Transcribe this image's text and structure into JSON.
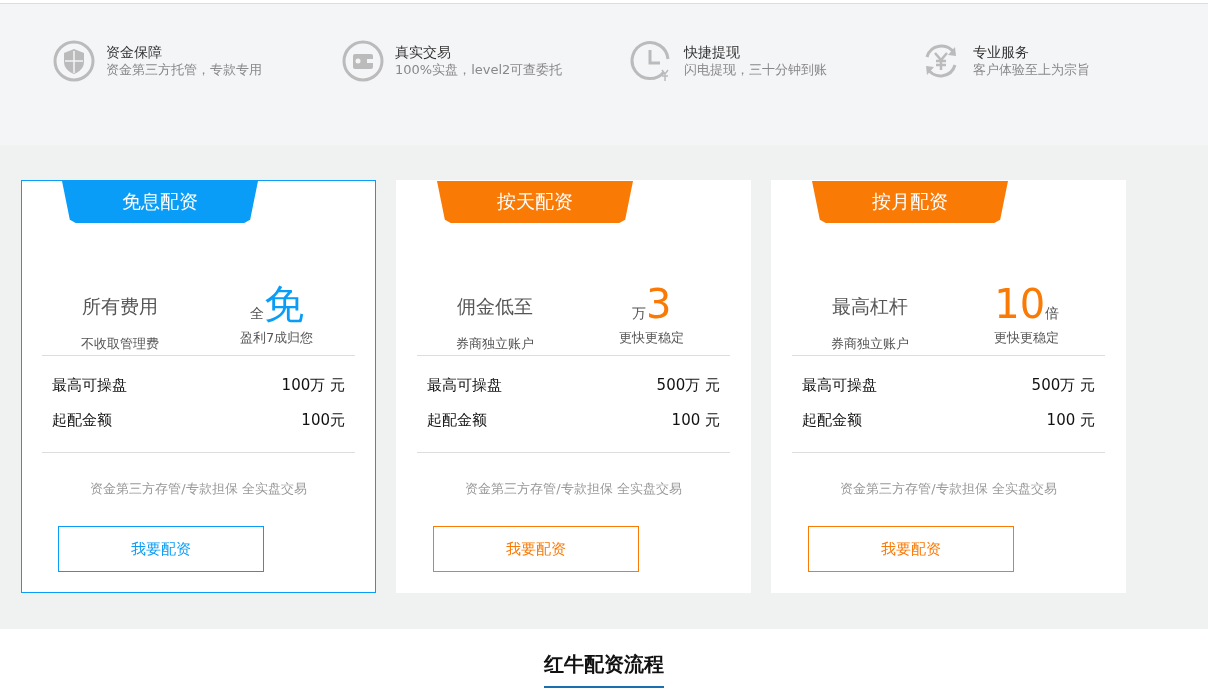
{
  "features": [
    {
      "kind": "shield",
      "title": "资金保障",
      "desc": "资金第三方托管，专款专用"
    },
    {
      "kind": "wallet",
      "title": "真实交易",
      "desc": "100%实盘，level2可查委托"
    },
    {
      "kind": "clock",
      "title": "快捷提现",
      "desc": "闪电提现，三十分钟到账"
    },
    {
      "kind": "exchange",
      "title": "专业服务",
      "desc": "客户体验至上为宗旨"
    }
  ],
  "plans": [
    {
      "selected": true,
      "color": "#0a9df7",
      "tab": "免息配资",
      "left_title": "所有费用",
      "left_sub": "不收取管理费",
      "figure_prefix": "全",
      "figure": "免",
      "right_sub": "盈利7成归您",
      "rows": [
        {
          "label": "最高可操盘",
          "value": "100万 元"
        },
        {
          "label": "起配金额",
          "value": "100元"
        }
      ],
      "note": "资金第三方存管/专款担保 全实盘交易",
      "button": "我要配资"
    },
    {
      "selected": false,
      "color": "#fa7a06",
      "tab": "按天配资",
      "left_title": "佣金低至",
      "left_sub": "券商独立账户",
      "figure_prefix": "万",
      "figure": "3",
      "right_sub": "更快更稳定",
      "rows": [
        {
          "label": "最高可操盘",
          "value": "500万 元"
        },
        {
          "label": "起配金额",
          "value": "100 元"
        }
      ],
      "note": "资金第三方存管/专款担保 全实盘交易",
      "button": "我要配资"
    },
    {
      "selected": false,
      "color": "#fa7a06",
      "tab": "按月配资",
      "left_title": "最高杠杆",
      "left_sub": "券商独立账户",
      "figure": "10",
      "figure_suffix": "倍",
      "right_sub": "更快更稳定",
      "rows": [
        {
          "label": "最高可操盘",
          "value": "500万 元"
        },
        {
          "label": "起配金额",
          "value": "100 元"
        }
      ],
      "note": "资金第三方存管/专款担保 全实盘交易",
      "button": "我要配资"
    }
  ],
  "section_title": "红牛配资流程"
}
